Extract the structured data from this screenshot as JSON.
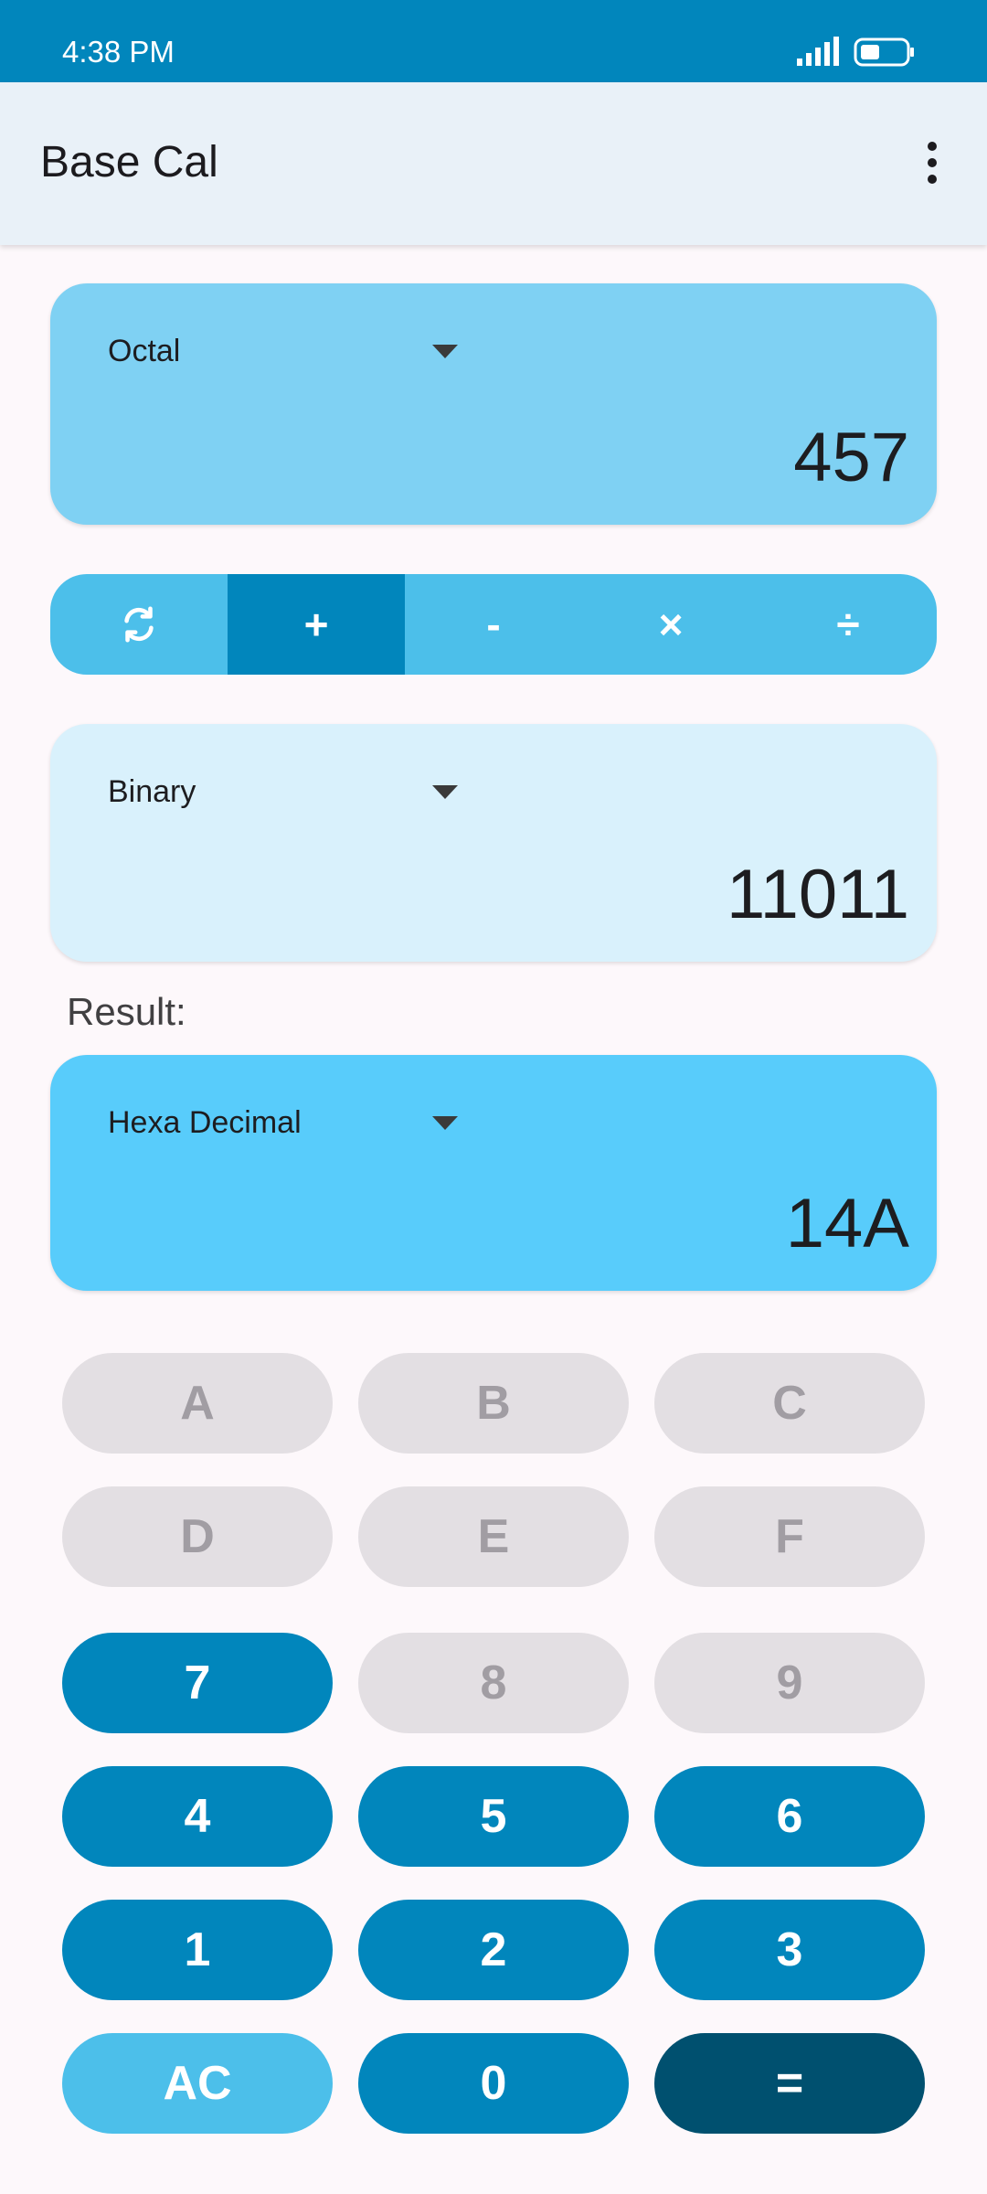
{
  "status_bar": {
    "time": "4:38 PM"
  },
  "app_bar": {
    "title": "Base Cal"
  },
  "input1": {
    "base": "Octal",
    "value": "457"
  },
  "operations": [
    {
      "label": "swap-icon"
    },
    {
      "label": "+"
    },
    {
      "label": "-"
    },
    {
      "label": "×"
    },
    {
      "label": "÷"
    }
  ],
  "input2": {
    "base": "Binary",
    "value": "11011"
  },
  "result": {
    "label": "Result:",
    "base": "Hexa Decimal",
    "value": "14A"
  },
  "keypad": {
    "k_a": "A",
    "k_b": "B",
    "k_c": "C",
    "k_d": "D",
    "k_e": "E",
    "k_f": "F",
    "k_7": "7",
    "k_8": "8",
    "k_9": "9",
    "k_4": "4",
    "k_5": "5",
    "k_6": "6",
    "k_1": "1",
    "k_2": "2",
    "k_3": "3",
    "k_ac": "AC",
    "k_0": "0",
    "k_eq": "="
  },
  "colors": {
    "primary": "#0186bc",
    "dark": "#00506f",
    "accent": "#4cbfea",
    "input1_bg": "#7fd1f3",
    "input2_bg": "#d9f1fc",
    "result_bg": "#58ccfb",
    "disabled_key": "#e3dfe3"
  }
}
